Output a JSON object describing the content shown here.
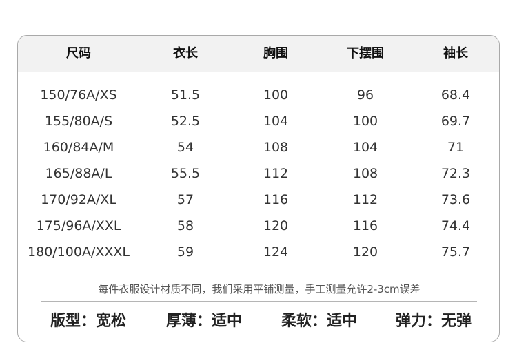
{
  "table": {
    "headers": [
      "尺码",
      "衣长",
      "胸围",
      "下摆围",
      "袖长"
    ],
    "rows": [
      [
        "150/76A/XS",
        "51.5",
        "100",
        "96",
        "68.4"
      ],
      [
        "155/80A/S",
        "52.5",
        "104",
        "100",
        "69.7"
      ],
      [
        "160/84A/M",
        "54",
        "108",
        "104",
        "71"
      ],
      [
        "165/88A/L",
        "55.5",
        "112",
        "108",
        "72.3"
      ],
      [
        "170/92A/XL",
        "57",
        "116",
        "112",
        "73.6"
      ],
      [
        "175/96A/XXL",
        "58",
        "120",
        "116",
        "74.4"
      ],
      [
        "180/100A/XXXL",
        "59",
        "124",
        "120",
        "75.7"
      ]
    ]
  },
  "note": "每件衣服设计材质不同，我们采用平铺测量，手工测量允许2-3cm误差",
  "attributes": [
    "版型：宽松",
    "厚薄：适中",
    "柔软：适中",
    "弹力：无弹"
  ]
}
